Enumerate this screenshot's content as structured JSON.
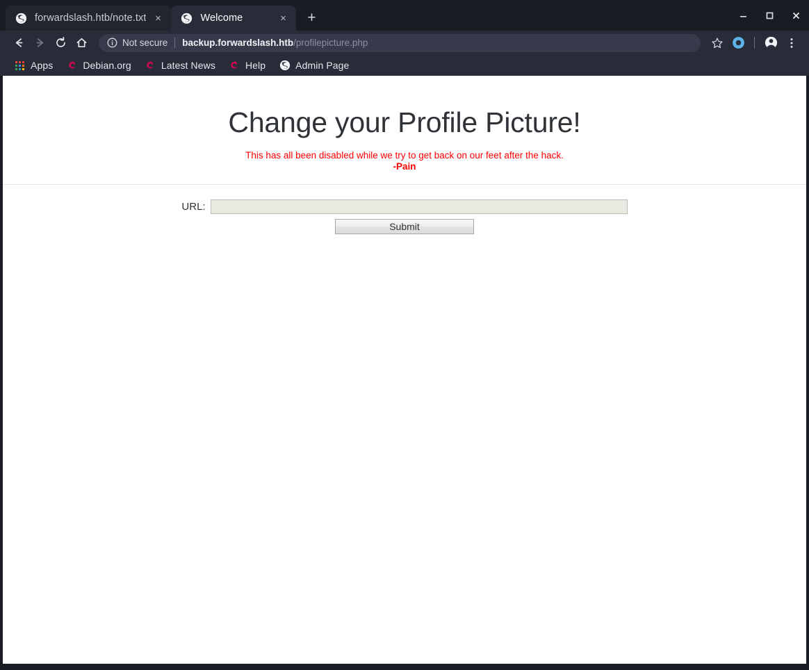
{
  "browser": {
    "tabs": [
      {
        "title": "forwardslash.htb/note.txt",
        "favicon": "globe-icon",
        "active": false,
        "close_label": "×"
      },
      {
        "title": "Welcome",
        "favicon": "globe-icon",
        "active": true,
        "close_label": "×"
      }
    ],
    "new_tab_label": "+",
    "window_controls": {
      "minimize": "minimize-icon",
      "maximize": "maximize-icon",
      "close": "close-icon"
    },
    "nav": {
      "back": "back-arrow-icon",
      "forward": "forward-arrow-icon",
      "reload": "reload-icon",
      "home": "home-icon"
    },
    "omnibox": {
      "security_icon": "info-circle-icon",
      "security_text": "Not secure",
      "url_host": "backup.forwardslash.htb",
      "url_path": "/profilepicture.php",
      "full_url": "backup.forwardslash.htb/profilepicture.php"
    },
    "toolbar_right": {
      "bookmark_star": "star-icon",
      "extension": "extension-circle-icon",
      "profile": "account-avatar-icon",
      "menu": "three-dots-menu-icon"
    },
    "bookmarks": [
      {
        "label": "Apps",
        "icon": "apps-grid-icon"
      },
      {
        "label": "Debian.org",
        "icon": "debian-swirl-icon"
      },
      {
        "label": "Latest News",
        "icon": "debian-swirl-icon"
      },
      {
        "label": "Help",
        "icon": "debian-swirl-icon"
      },
      {
        "label": "Admin Page",
        "icon": "globe-icon"
      }
    ]
  },
  "page": {
    "heading": "Change your Profile Picture!",
    "notice_line1": "This has all been disabled while we try to get back on our feet after the hack.",
    "notice_line2": "-Pain",
    "form": {
      "url_label": "URL:",
      "url_value": "",
      "url_placeholder": "",
      "submit_label": "Submit"
    }
  },
  "colors": {
    "tabstrip_bg": "#1a1c24",
    "toolbar_bg": "#282b38",
    "omnibox_bg": "#363a4a",
    "notice_red": "#ff0000",
    "debian_red": "#d70751",
    "heading_gray": "#2f3338",
    "input_bg": "#e9e9e1"
  }
}
